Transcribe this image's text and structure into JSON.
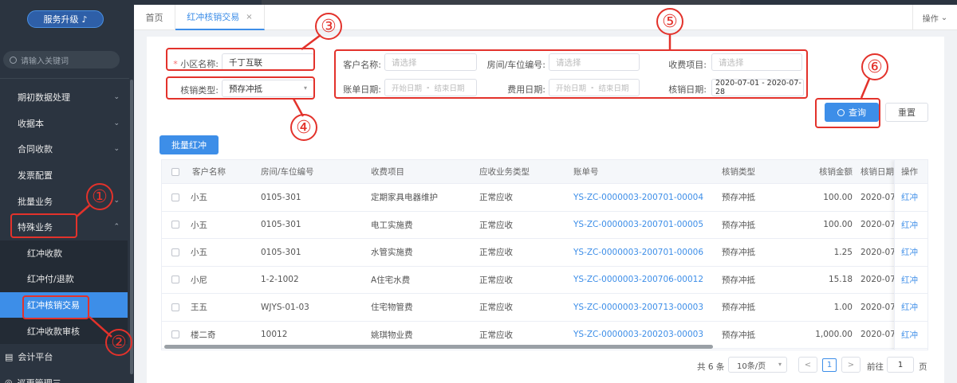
{
  "sidebar": {
    "upgrade_label": "服务升级",
    "upgrade_icon": "music-note-icon",
    "search_placeholder": "请输入关键词",
    "items": [
      {
        "label": "期初数据处理",
        "chevron": "⌄"
      },
      {
        "label": "收据本",
        "chevron": "⌄"
      },
      {
        "label": "合同收款",
        "chevron": "⌄"
      },
      {
        "label": "发票配置",
        "chevron": ""
      },
      {
        "label": "批量业务",
        "chevron": "⌄"
      },
      {
        "label": "特殊业务",
        "chevron": "⌃"
      },
      {
        "label": "红冲收款",
        "chevron": ""
      },
      {
        "label": "红冲付/退款",
        "chevron": ""
      },
      {
        "label": "红冲核销交易",
        "chevron": ""
      },
      {
        "label": "红冲收款审核",
        "chevron": ""
      },
      {
        "label": "会计平台",
        "chevron": ""
      },
      {
        "label": "巡更管理三",
        "chevron": ""
      }
    ]
  },
  "tabs": {
    "home": "首页",
    "current": "红冲核销交易",
    "close": "×",
    "ops": "操作"
  },
  "filters": {
    "community_label": "小区名称:",
    "required_mark": "*",
    "community_value": "千丁互联",
    "type_label": "核销类型:",
    "type_value": "预存冲抵",
    "customer_label": "客户名称:",
    "customer_placeholder": "请选择",
    "room_label": "房间/车位编号:",
    "room_placeholder": "请选择",
    "charge_label": "收费项目:",
    "charge_placeholder": "请选择",
    "bill_date_label": "账单日期:",
    "fee_date_label": "费用日期:",
    "date_start": "开始日期",
    "date_sep": "-",
    "date_end": "结束日期",
    "writeoff_date_label": "核销日期:",
    "writeoff_date_value": "2020-07-01 - 2020-07-28",
    "query_label": "查询",
    "reset_label": "重置",
    "batch_label": "批量红冲"
  },
  "table": {
    "headers": [
      "客户名称",
      "房间/车位编号",
      "收费项目",
      "应收业务类型",
      "账单号",
      "核销类型",
      "核销金额",
      "核销日期",
      "操作"
    ],
    "rows": [
      {
        "customer": "小五",
        "room": "0105-301",
        "item": "定期家具电器维护",
        "type": "正常应收",
        "bill": "YS-ZC-0000003-200701-00004",
        "wtype": "预存冲抵",
        "amount": "100.00",
        "date": "2020-07",
        "op": "红冲"
      },
      {
        "customer": "小五",
        "room": "0105-301",
        "item": "电工实施费",
        "type": "正常应收",
        "bill": "YS-ZC-0000003-200701-00005",
        "wtype": "预存冲抵",
        "amount": "100.00",
        "date": "2020-07",
        "op": "红冲"
      },
      {
        "customer": "小五",
        "room": "0105-301",
        "item": "水管实施费",
        "type": "正常应收",
        "bill": "YS-ZC-0000003-200701-00006",
        "wtype": "预存冲抵",
        "amount": "1.25",
        "date": "2020-07",
        "op": "红冲"
      },
      {
        "customer": "小尼",
        "room": "1-2-1002",
        "item": "A住宅水费",
        "type": "正常应收",
        "bill": "YS-ZC-0000003-200706-00012",
        "wtype": "预存冲抵",
        "amount": "15.18",
        "date": "2020-07",
        "op": "红冲"
      },
      {
        "customer": "王五",
        "room": "WJYS-01-03",
        "item": "住宅物管费",
        "type": "正常应收",
        "bill": "YS-ZC-0000003-200713-00003",
        "wtype": "预存冲抵",
        "amount": "1.00",
        "date": "2020-07",
        "op": "红冲"
      },
      {
        "customer": "楼二奇",
        "room": "10012",
        "item": "姚琪物业费",
        "type": "正常应收",
        "bill": "YS-ZC-0000003-200203-00003",
        "wtype": "预存冲抵",
        "amount": "1,000.00",
        "date": "2020-07",
        "op": "红冲"
      }
    ]
  },
  "pagination": {
    "total": "共 6 条",
    "page_size": "10条/页",
    "prev": "<",
    "current": "1",
    "next": ">",
    "goto_label": "前往",
    "goto_value": "1",
    "page_suffix": "页"
  },
  "annotations": [
    "①",
    "②",
    "③",
    "④",
    "⑤",
    "⑥"
  ],
  "colors": {
    "accent": "#3d8ee8",
    "sidebar": "#2b3440",
    "annotation": "#e3322b"
  }
}
